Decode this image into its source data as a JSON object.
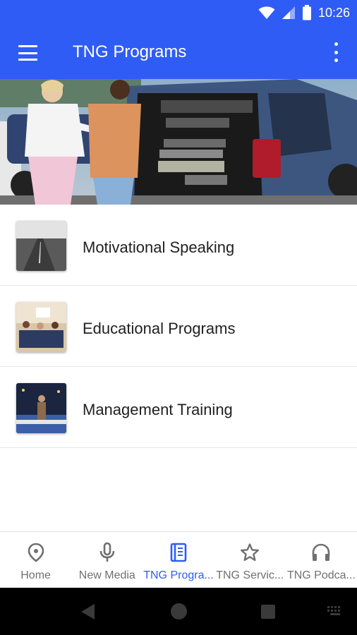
{
  "status_bar": {
    "time": "10:26",
    "icons": [
      "wifi-icon",
      "cell-signal-icon",
      "battery-icon"
    ]
  },
  "app_bar": {
    "title": "TNG Programs",
    "menu_icon": "hamburger-menu-icon",
    "overflow_icon": "more-vert-icon"
  },
  "hero": {
    "image": "Photo of two people beside an SUV with audio equipment in the trunk"
  },
  "programs": [
    {
      "label": "Motivational Speaking",
      "thumbnail": "road-photo"
    },
    {
      "label": "Educational Programs",
      "thumbnail": "classroom-photo"
    },
    {
      "label": "Management Training",
      "thumbnail": "stage-speaker-photo"
    }
  ],
  "bottom_nav": {
    "items": [
      {
        "label": "Home",
        "icon": "location-pin-icon",
        "active": false
      },
      {
        "label": "New Media",
        "icon": "microphone-icon",
        "active": false
      },
      {
        "label": "TNG Progra...",
        "icon": "book-icon",
        "active": true
      },
      {
        "label": "TNG Servic...",
        "icon": "star-icon",
        "active": false
      },
      {
        "label": "TNG Podca...",
        "icon": "headphones-icon",
        "active": false
      }
    ]
  },
  "colors": {
    "primary": "#2f5cf5",
    "text": "#212121",
    "inactive_nav": "#707070",
    "system_nav": "#000000"
  }
}
